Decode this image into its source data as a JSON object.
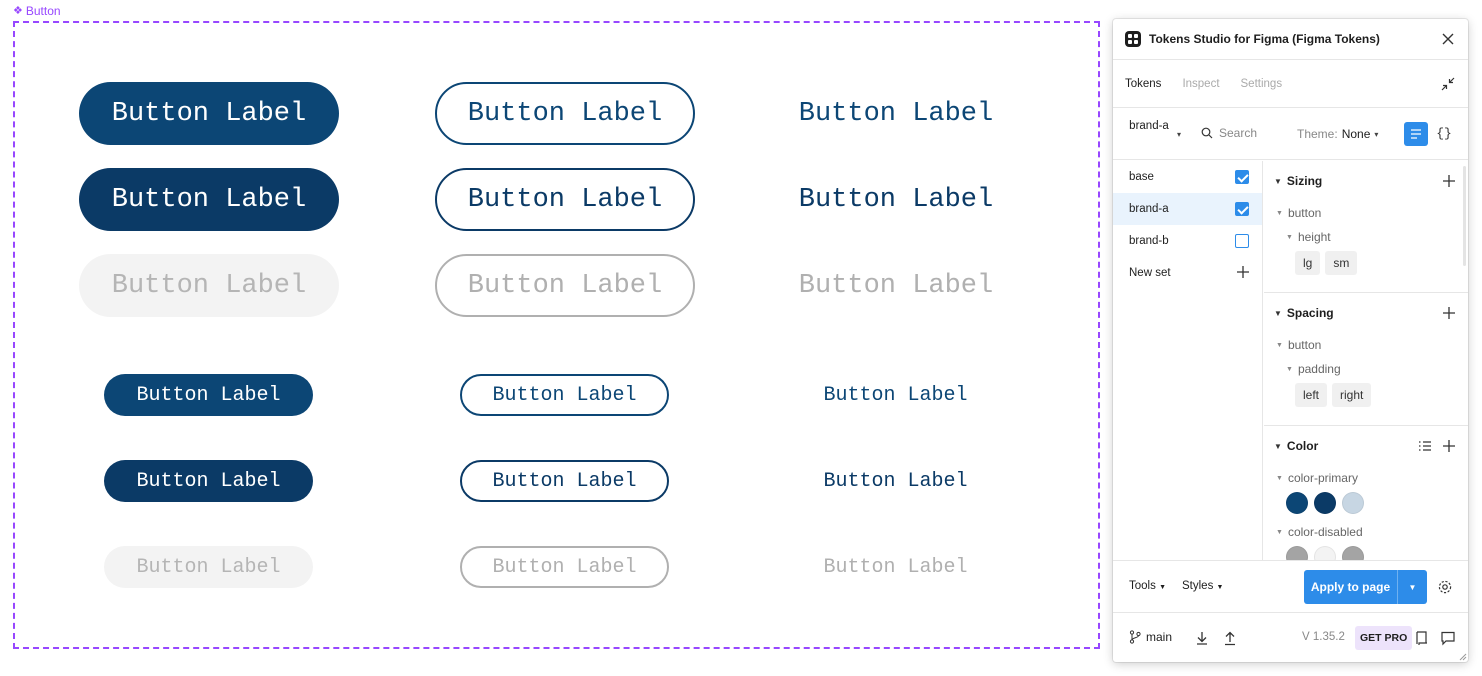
{
  "frame": {
    "label": "Button",
    "accent": "#9747ff"
  },
  "buttons": {
    "label": "Button Label",
    "colors": {
      "primary": "#0c4675",
      "primary_hover": "#0b3a66",
      "disabled_bg": "#f3f3f3",
      "disabled_text": "#b0b0b0"
    }
  },
  "plugin": {
    "title": "Tokens Studio for Figma (Figma Tokens)",
    "tabs": [
      {
        "label": "Tokens",
        "active": true
      },
      {
        "label": "Inspect",
        "active": false
      },
      {
        "label": "Settings",
        "active": false
      }
    ],
    "toolbar": {
      "set_select": "brand-a",
      "search_placeholder": "Search",
      "theme_label": "Theme:",
      "theme_value": "None",
      "json_toggle": "{}"
    },
    "token_sets": [
      {
        "name": "base",
        "checked": true,
        "selected": false
      },
      {
        "name": "brand-a",
        "checked": true,
        "selected": true
      },
      {
        "name": "brand-b",
        "checked": false,
        "selected": false
      }
    ],
    "new_set_label": "New set",
    "groups": {
      "sizing": {
        "title": "Sizing",
        "parent": "button",
        "child": "height",
        "tokens": [
          "lg",
          "sm"
        ]
      },
      "spacing": {
        "title": "Spacing",
        "parent": "button",
        "child": "padding",
        "tokens": [
          "left",
          "right"
        ]
      },
      "color": {
        "title": "Color",
        "primary_label": "color-primary",
        "primary_swatches": [
          "#0c4675",
          "#0b3a66",
          "#c7d6e3"
        ],
        "disabled_label": "color-disabled",
        "disabled_swatches": [
          "#a4a4a4",
          "#f3f3f3",
          "#a4a4a4"
        ]
      }
    },
    "footer": {
      "tools_label": "Tools",
      "styles_label": "Styles",
      "apply_label": "Apply to page",
      "branch": "main",
      "version": "V 1.35.2",
      "get_pro": "GET PRO"
    },
    "accent": "#2d8ce9"
  }
}
